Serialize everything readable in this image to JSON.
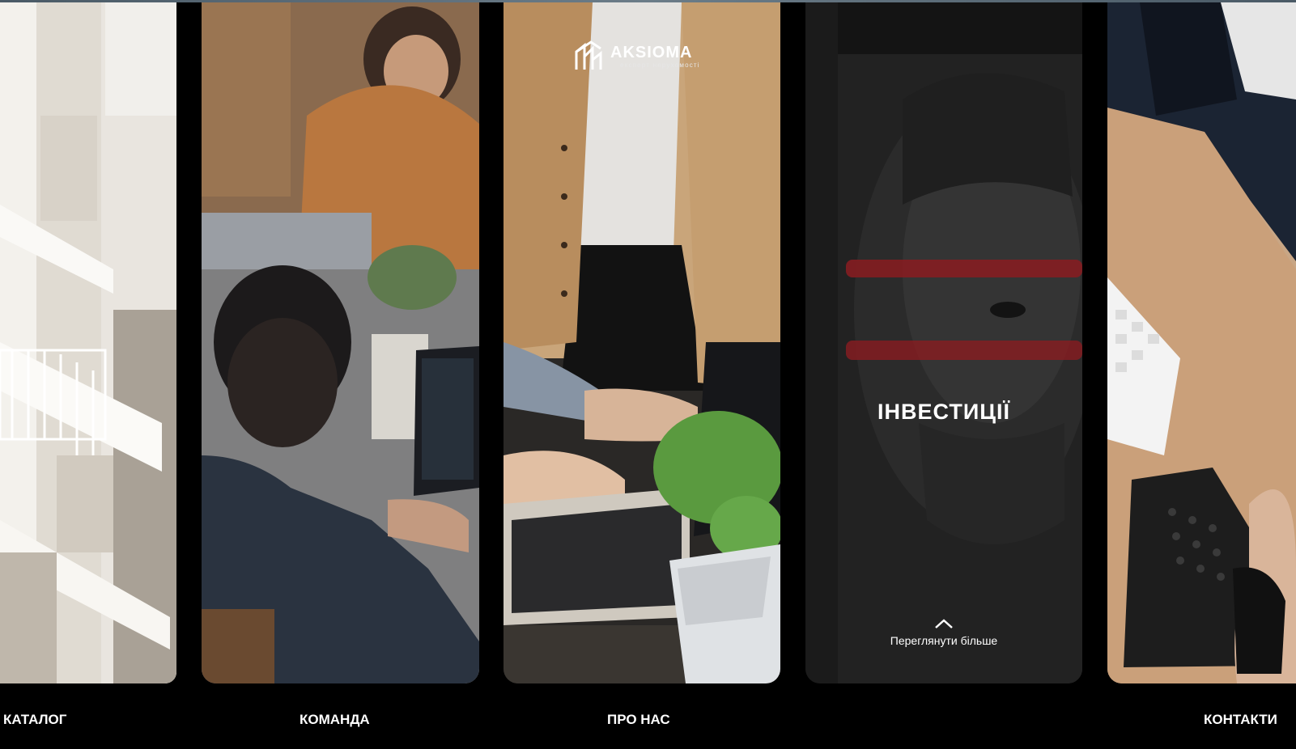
{
  "brand": {
    "name": "AKSIOMA",
    "tagline": "експерт нерухомості",
    "logo_icon": "aksioma-logo-mark"
  },
  "panels": [
    {
      "id": "catalog",
      "image": "building-balconies-photo"
    },
    {
      "id": "team",
      "image": "people-working-laptops-photo"
    },
    {
      "id": "about",
      "image": "hands-laptop-succulent-photo"
    },
    {
      "id": "investments",
      "image": "banknote-portrait-photo",
      "title": "ІНВЕСТИЦІЇ",
      "cta": "Переглянути більше",
      "cta_icon": "chevron-up-icon"
    },
    {
      "id": "contacts",
      "image": "hand-desk-phone-keyboard-photo"
    }
  ],
  "nav": {
    "catalog": "КАТАЛОГ",
    "team": "КОМАНДА",
    "about": "ПРО НАС",
    "contacts": "КОНТАКТИ"
  },
  "colors": {
    "background": "#000000",
    "text": "#ffffff",
    "accent_red": "#b8262c"
  }
}
